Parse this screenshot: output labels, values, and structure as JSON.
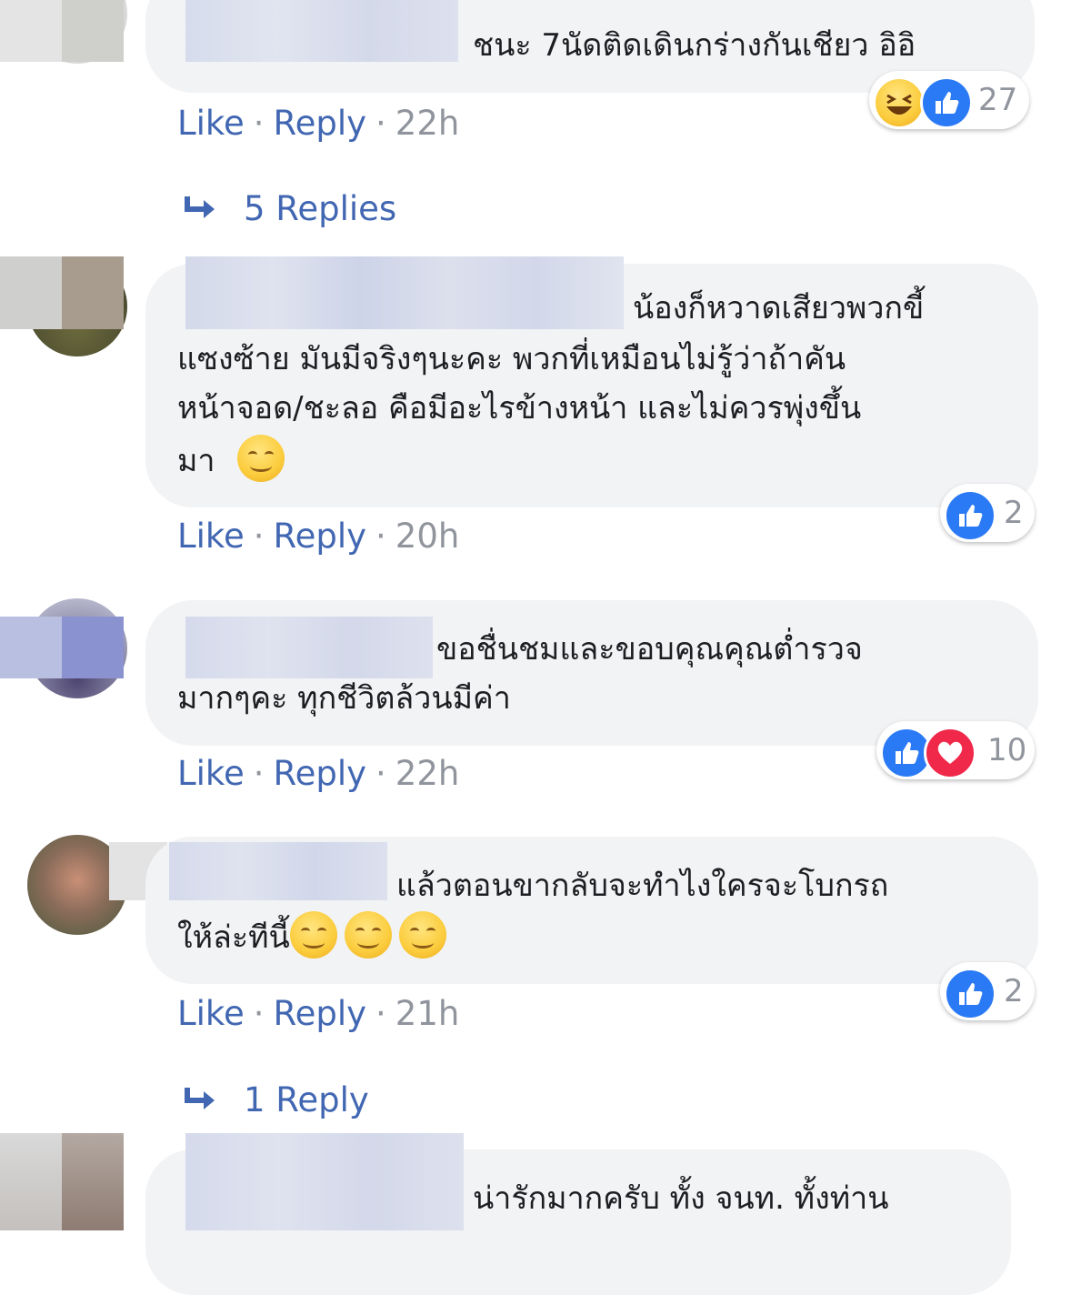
{
  "comments": [
    {
      "text_lines": [
        "ชนะ 7นัดติดเดินกร่างกันเชียว อิอิ"
      ],
      "emoji": [],
      "actions": {
        "like": "Like",
        "reply": "Reply",
        "time": "22h"
      },
      "reaction_count": "27",
      "reaction_icons": [
        "haha-icon",
        "like-icon"
      ],
      "replies_label": "5 Replies"
    },
    {
      "text_lines": [
        "น้องก็หวาดเสียวพวกขี้",
        "แซงซ้าย มันมีจริงๆนะคะ พวกที่เหมือนไม่รู้ว่าถ้าคัน",
        "หน้าจอด/ชะลอ คือมีอะไรข้างหน้า และไม่ควรพุ่งขึ้น",
        "มา"
      ],
      "emoji": [
        "relieved-emoji"
      ],
      "actions": {
        "like": "Like",
        "reply": "Reply",
        "time": "20h"
      },
      "reaction_count": "2",
      "reaction_icons": [
        "like-icon"
      ]
    },
    {
      "text_lines": [
        "ขอชื่นชมและขอบคุณคุณต่ำรวจ",
        "มากๆคะ ทุกชีวิตล้วนมีค่า"
      ],
      "emoji": [],
      "actions": {
        "like": "Like",
        "reply": "Reply",
        "time": "22h"
      },
      "reaction_count": "10",
      "reaction_icons": [
        "like-icon",
        "love-icon"
      ]
    },
    {
      "text_lines": [
        "แล้วตอนขากลับจะทำไงใครจะโบกรถ",
        "ให้ล่ะทีนี้"
      ],
      "emoji": [
        "blush-emoji",
        "blush-emoji",
        "blush-emoji"
      ],
      "actions": {
        "like": "Like",
        "reply": "Reply",
        "time": "21h"
      },
      "reaction_count": "2",
      "reaction_icons": [
        "like-icon"
      ],
      "replies_label": "1 Reply"
    },
    {
      "text_lines": [
        "น่ารักมากครับ ทั้ง จนท. ทั้งท่าน"
      ]
    }
  ],
  "colors": {
    "link": "#4267b2",
    "meta": "#90949c",
    "bubble": "#f2f3f5",
    "like": "#2b7af5",
    "love": "#f0284a"
  }
}
